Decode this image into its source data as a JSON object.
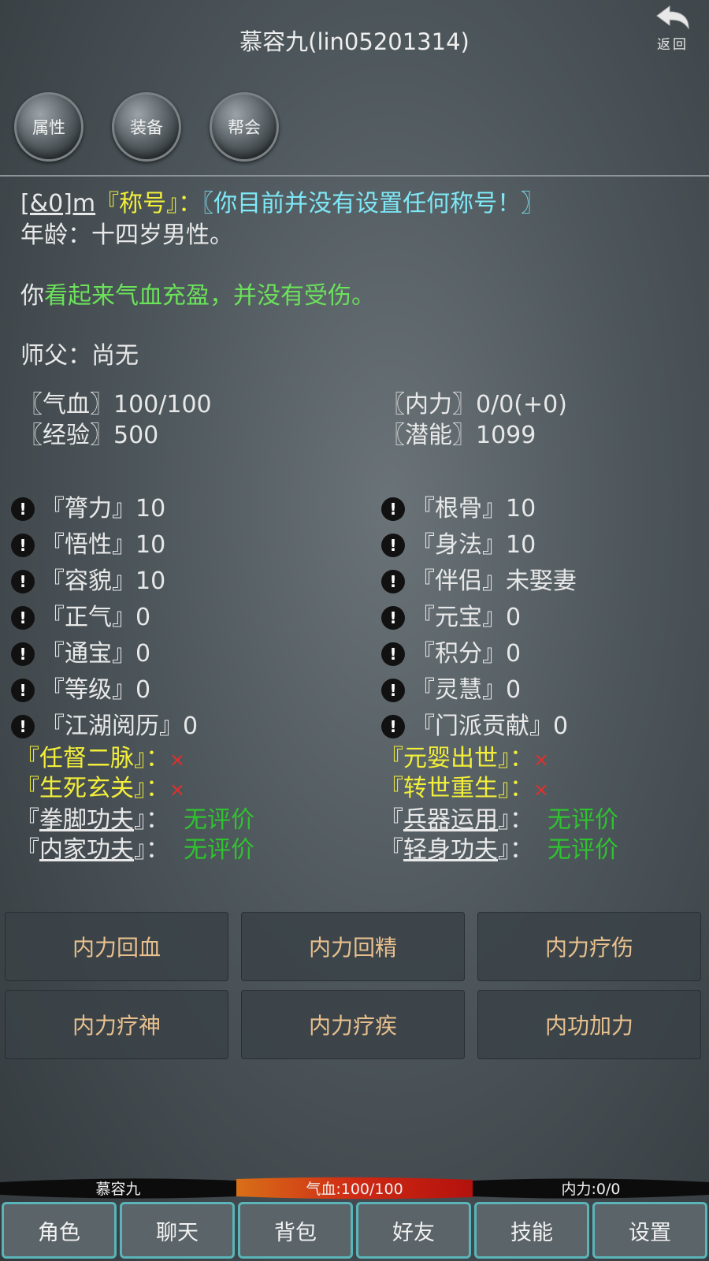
{
  "header": {
    "title": "慕容九(lin05201314)",
    "back_label": "返回"
  },
  "tabs": [
    {
      "label": "属性"
    },
    {
      "label": "装备"
    },
    {
      "label": "帮会"
    }
  ],
  "profile": {
    "code": "[&0]m",
    "title_label": "『称号』：",
    "title_value": "〖你目前并没有设置任何称号！〗",
    "age_line": "年龄：十四岁男性。",
    "health_prefix": "你",
    "health_status": "看起来气血充盈，并没有受伤。",
    "master_line": "师父：尚无"
  },
  "vitals": {
    "qixue": "〖气血〗100/100",
    "neili": "〖内力〗0/0(+0)",
    "jingyan": "〖经验〗500",
    "qianneng": "〖潜能〗1099"
  },
  "attributes_left": [
    "『膂力』10",
    "『悟性』10",
    "『容貌』10",
    "『正气』0",
    "『通宝』0",
    "『等级』0",
    "『江湖阅历』0"
  ],
  "attributes_right": [
    "『根骨』10",
    "『身法』10",
    "『伴侣』未娶妻",
    "『元宝』0",
    "『积分』0",
    "『灵慧』0",
    "『门派贡献』0"
  ],
  "achievements": {
    "left": [
      {
        "label": "『任督二脉』：",
        "value": "×"
      },
      {
        "label": "『生死玄关』：",
        "value": "×"
      }
    ],
    "right": [
      {
        "label": "『元婴出世』：",
        "value": "×"
      },
      {
        "label": "『转世重生』：",
        "value": "×"
      }
    ]
  },
  "skills": {
    "left": [
      {
        "open": "『",
        "name": "拳脚功夫",
        "close": "』：",
        "value": "无评价"
      },
      {
        "open": "『",
        "name": "内家功夫",
        "close": "』：",
        "value": "无评价"
      }
    ],
    "right": [
      {
        "open": "『",
        "name": "兵器运用",
        "close": "』：",
        "value": "无评价"
      },
      {
        "open": "『",
        "name": "轻身功夫",
        "close": "』：",
        "value": "无评价"
      }
    ]
  },
  "actions": [
    "内力回血",
    "内力回精",
    "内力疗伤",
    "内力疗神",
    "内力疗疾",
    "内功加力"
  ],
  "status": {
    "name": "慕容九",
    "qixue": "气血:100/100",
    "neili": "内力:0/0",
    "qixue_ratio": 1.0
  },
  "bottom_nav": [
    "角色",
    "聊天",
    "背包",
    "好友",
    "技能",
    "设置"
  ],
  "colors": {
    "title_cyan": "#7ee8f6",
    "highlight_yellow": "#f2ee3a",
    "health_green": "#6be25a",
    "rating_green": "#2fc32f",
    "cross_red": "#e0302c",
    "action_text": "#e8c08e",
    "nav_border": "#5ab4b8"
  }
}
